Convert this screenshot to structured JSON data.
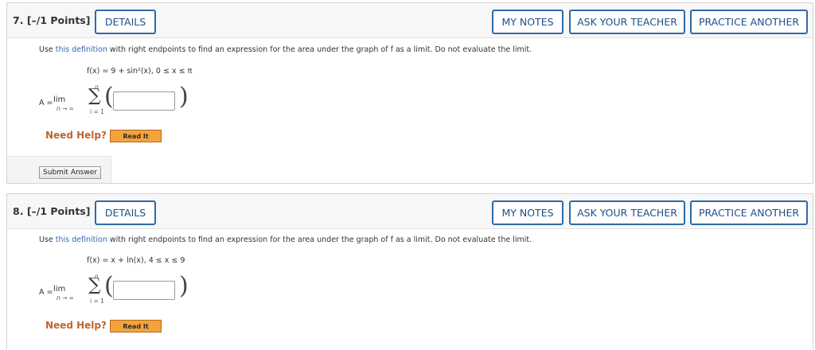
{
  "questions": [
    {
      "number": "7.",
      "points": "[–/1 Points]",
      "details_label": "DETAILS",
      "my_notes_label": "MY NOTES",
      "ask_teacher_label": "ASK YOUR TEACHER",
      "practice_label": "PRACTICE ANOTHER",
      "prompt_pre": "Use ",
      "prompt_link": "this definition",
      "prompt_post": " with right endpoints to find an expression for the area under the graph of f as a limit. Do not evaluate the limit.",
      "function": "f(x) = 9 + sin²(x),    0 ≤ x ≤ π",
      "formula": {
        "a_eq": "A =",
        "lim": "lim",
        "lim_sub": "n → ∞",
        "sum_top": "n",
        "sigma": "∑",
        "sum_bottom": "i = 1",
        "lparen": "(",
        "rparen": ")"
      },
      "answer_value": "",
      "need_help": "Need Help?",
      "read_it": "Read It",
      "submit_label": "Submit Answer"
    },
    {
      "number": "8.",
      "points": "[–/1 Points]",
      "details_label": "DETAILS",
      "my_notes_label": "MY NOTES",
      "ask_teacher_label": "ASK YOUR TEACHER",
      "practice_label": "PRACTICE ANOTHER",
      "prompt_pre": "Use ",
      "prompt_link": "this definition",
      "prompt_post": " with right endpoints to find an expression for the area under the graph of f as a limit. Do not evaluate the limit.",
      "function": "f(x) = x + ln(x),    4 ≤ x ≤ 9",
      "formula": {
        "a_eq": "A =",
        "lim": "lim",
        "lim_sub": "n → ∞",
        "sum_top": "n",
        "sigma": "∑",
        "sum_bottom": "i = 1",
        "lparen": "(",
        "rparen": ")"
      },
      "answer_value": "",
      "need_help": "Need Help?",
      "read_it": "Read It"
    }
  ],
  "colors": {
    "header_button_border": "#2e6aa9",
    "link": "#2d6bb3",
    "need_help": "#c0642f",
    "read_it_bg": "#f3a33a"
  }
}
